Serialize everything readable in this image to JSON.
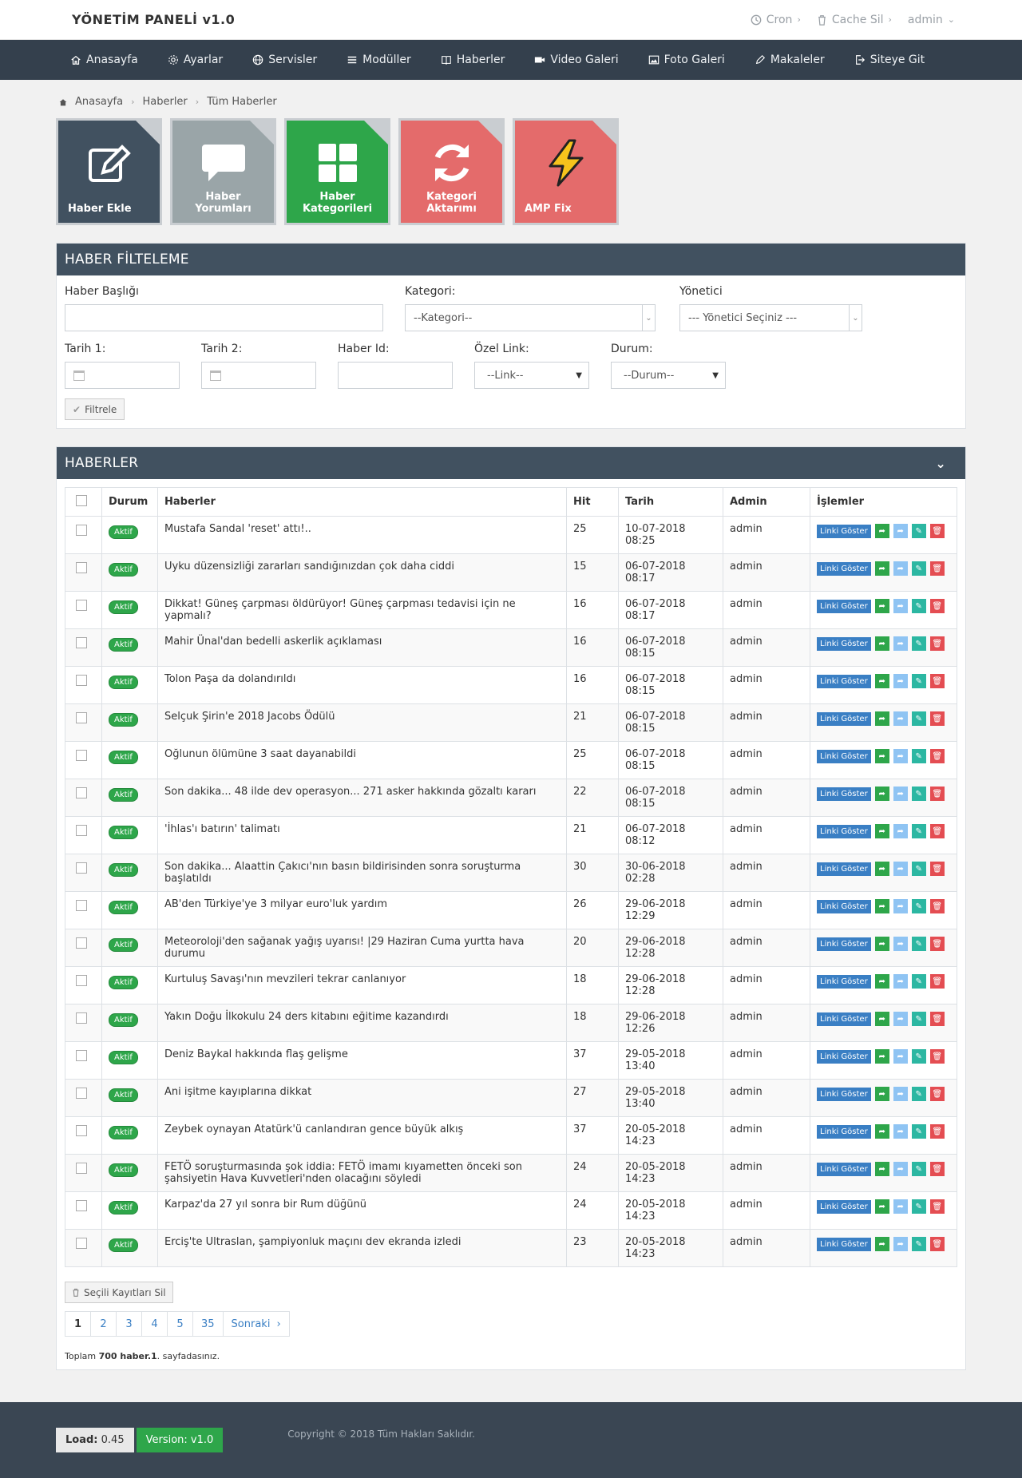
{
  "brand": "YÖNETİM PANELİ v1.0",
  "topbar": {
    "cron": "Cron",
    "cache": "Cache Sil",
    "user": "admin"
  },
  "nav": [
    {
      "label": "Anasayfa"
    },
    {
      "label": "Ayarlar"
    },
    {
      "label": "Servisler"
    },
    {
      "label": "Modüller"
    },
    {
      "label": "Haberler"
    },
    {
      "label": "Video Galeri"
    },
    {
      "label": "Foto Galeri"
    },
    {
      "label": "Makaleler"
    },
    {
      "label": "Siteye Git"
    }
  ],
  "breadcrumb": [
    "Anasayfa",
    "Haberler",
    "Tüm Haberler"
  ],
  "tiles": [
    {
      "label": "Haber Ekle",
      "color": "#415160",
      "icon": "edit-icon"
    },
    {
      "label": "Haber Yorumları",
      "color": "#9aa5a8",
      "icon": "comment-icon"
    },
    {
      "label": "Haber Kategorileri",
      "color": "#2ea64a",
      "icon": "grid-icon"
    },
    {
      "label": "Kategori Aktarımı",
      "color": "#e46b6b",
      "icon": "refresh-icon"
    },
    {
      "label": "AMP Fix",
      "color": "#e46b6b",
      "icon": "bolt-icon"
    }
  ],
  "filter": {
    "title": "HABER FİLTELEME",
    "haber_basligi_label": "Haber Başlığı",
    "kategori_label": "Kategori:",
    "kategori_value": "--Kategori--",
    "yonetici_label": "Yönetici",
    "yonetici_value": "--- Yönetici Seçiniz ---",
    "tarih1_label": "Tarih 1:",
    "tarih2_label": "Tarih 2:",
    "haber_id_label": "Haber Id:",
    "ozel_link_label": "Özel Link:",
    "ozel_link_value": "--Link--",
    "durum_label": "Durum:",
    "durum_value": "--Durum--",
    "button": "Filtrele"
  },
  "news_panel": {
    "title": "HABERLER",
    "columns": {
      "durum": "Durum",
      "haberler": "Haberler",
      "hit": "Hit",
      "tarih": "Tarih",
      "admin": "Admin",
      "islemler": "İşlemler"
    },
    "status_label": "Aktif",
    "link_button": "Linki Göster",
    "rows": [
      {
        "title": "Mustafa Sandal 'reset' attı!..",
        "hit": "25",
        "date": "10-07-2018 08:25",
        "admin": "admin"
      },
      {
        "title": "Uyku düzensizliği zararları sandığınızdan çok daha ciddi",
        "hit": "15",
        "date": "06-07-2018 08:17",
        "admin": "admin"
      },
      {
        "title": "Dikkat! Güneş çarpması öldürüyor! Güneş çarpması tedavisi için ne yapmalı?",
        "hit": "16",
        "date": "06-07-2018 08:17",
        "admin": "admin"
      },
      {
        "title": "Mahir Ünal'dan bedelli askerlik açıklaması",
        "hit": "16",
        "date": "06-07-2018 08:15",
        "admin": "admin"
      },
      {
        "title": "Tolon Paşa da dolandırıldı",
        "hit": "16",
        "date": "06-07-2018 08:15",
        "admin": "admin"
      },
      {
        "title": "Selçuk Şirin'e 2018 Jacobs Ödülü",
        "hit": "21",
        "date": "06-07-2018 08:15",
        "admin": "admin"
      },
      {
        "title": "Oğlunun ölümüne 3 saat dayanabildi",
        "hit": "25",
        "date": "06-07-2018 08:15",
        "admin": "admin"
      },
      {
        "title": "Son dakika... 48 ilde dev operasyon... 271 asker hakkında gözaltı kararı",
        "hit": "22",
        "date": "06-07-2018 08:15",
        "admin": "admin"
      },
      {
        "title": "'İhlas'ı batırın' talimatı",
        "hit": "21",
        "date": "06-07-2018 08:12",
        "admin": "admin"
      },
      {
        "title": "Son dakika... Alaattin Çakıcı'nın basın bildirisinden sonra soruşturma başlatıldı",
        "hit": "30",
        "date": "30-06-2018 02:28",
        "admin": "admin"
      },
      {
        "title": "AB'den Türkiye'ye 3 milyar euro'luk yardım",
        "hit": "26",
        "date": "29-06-2018 12:29",
        "admin": "admin"
      },
      {
        "title": "Meteoroloji'den sağanak yağış uyarısı! |29 Haziran  Cuma yurtta hava durumu",
        "hit": "20",
        "date": "29-06-2018 12:28",
        "admin": "admin"
      },
      {
        "title": "Kurtuluş Savaşı'nın mevzileri tekrar canlanıyor",
        "hit": "18",
        "date": "29-06-2018 12:28",
        "admin": "admin"
      },
      {
        "title": "Yakın Doğu İlkokulu 24 ders kitabını eğitime kazandırdı",
        "hit": "18",
        "date": "29-06-2018 12:26",
        "admin": "admin"
      },
      {
        "title": "Deniz Baykal hakkında flaş gelişme",
        "hit": "37",
        "date": "29-05-2018 13:40",
        "admin": "admin"
      },
      {
        "title": "Ani işitme kayıplarına dikkat",
        "hit": "27",
        "date": "29-05-2018 13:40",
        "admin": "admin"
      },
      {
        "title": "Zeybek oynayan Atatürk'ü canlandıran gence büyük alkış",
        "hit": "37",
        "date": "20-05-2018 14:23",
        "admin": "admin"
      },
      {
        "title": "FETÖ soruşturmasında şok iddia: FETÖ imamı kıyametten önceki son şahsiyetin Hava Kuvvetleri'nden olacağını söyledi",
        "hit": "24",
        "date": "20-05-2018 14:23",
        "admin": "admin"
      },
      {
        "title": "Karpaz'da 27 yıl sonra bir Rum düğünü",
        "hit": "24",
        "date": "20-05-2018 14:23",
        "admin": "admin"
      },
      {
        "title": "Erciş'te Ultraslan, şampiyonluk maçını dev ekranda izledi",
        "hit": "23",
        "date": "20-05-2018 14:23",
        "admin": "admin"
      }
    ],
    "bulk_delete": "Seçili Kayıtları Sil",
    "pages": [
      "1",
      "2",
      "3",
      "4",
      "5",
      "35"
    ],
    "next": "Sonraki",
    "total_prefix": "Toplam ",
    "total_count": "700 haber",
    "total_page": ".1",
    "total_suffix": ". sayfadasınız."
  },
  "footer": {
    "load_label": "Load:",
    "load_value": "0.45",
    "version": "Version: v1.0",
    "copyright": "Copyright © 2018 Tüm Hakları Saklıdır."
  }
}
